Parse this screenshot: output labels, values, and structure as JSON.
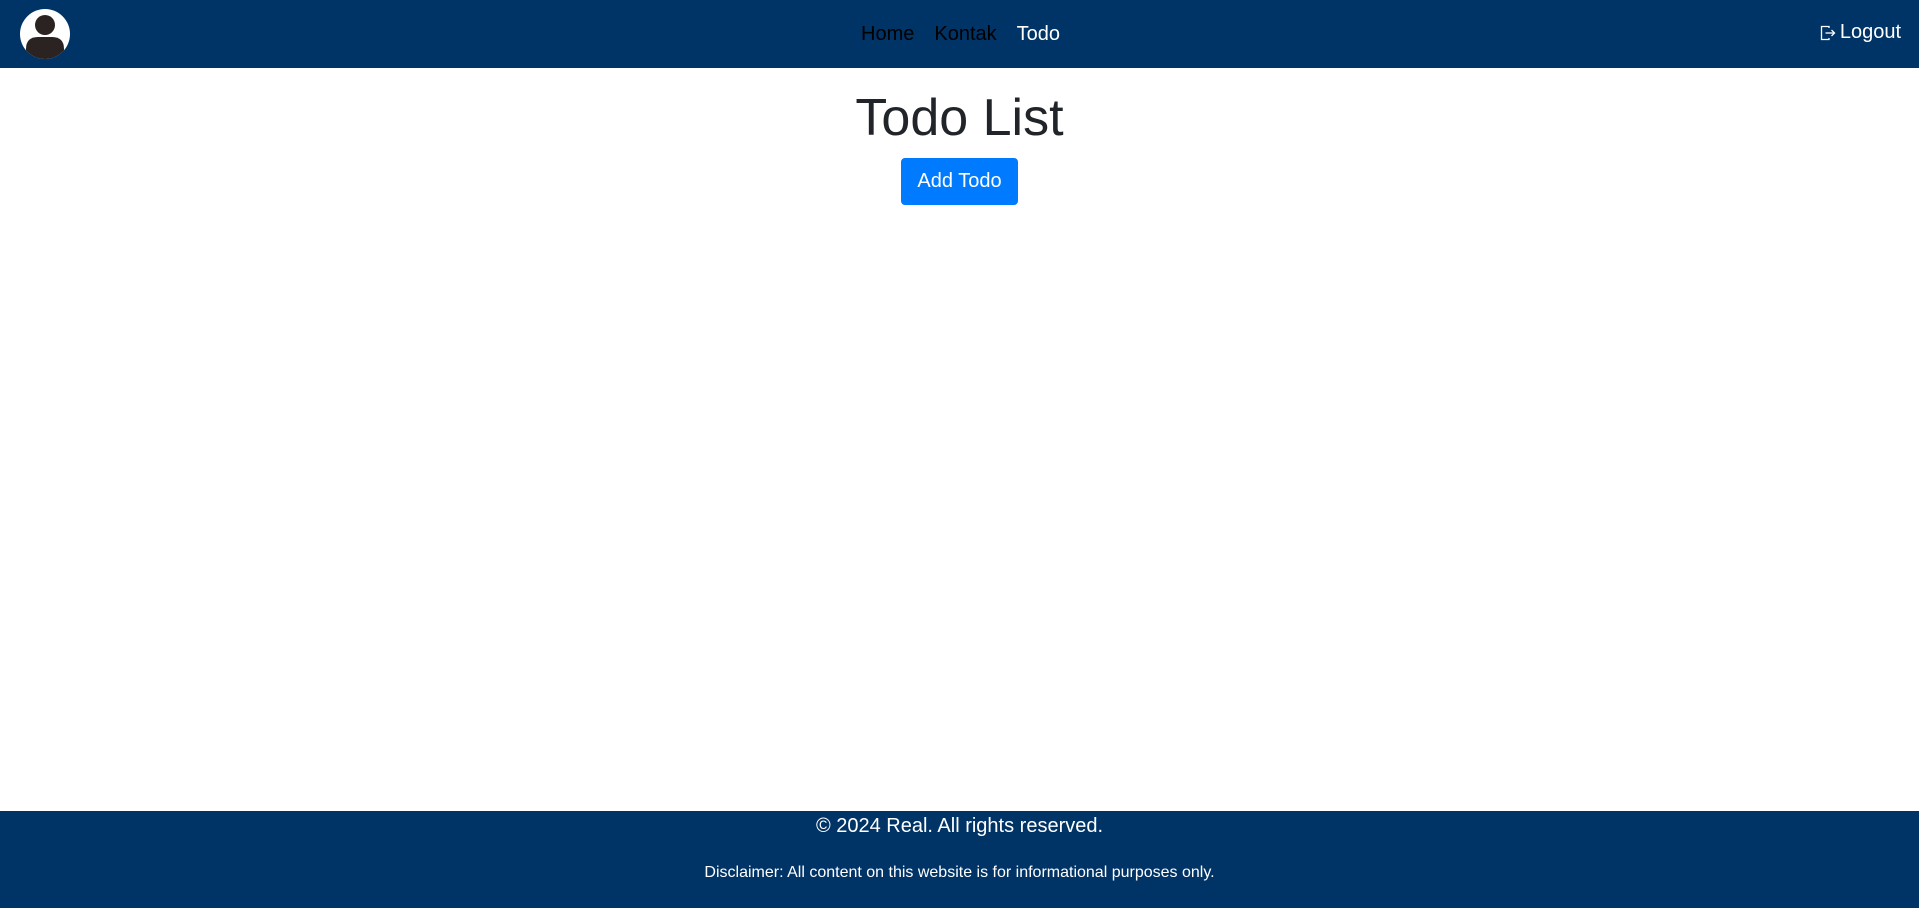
{
  "navbar": {
    "avatar_icon": "user-avatar-icon",
    "links": [
      {
        "label": "Home",
        "active": false
      },
      {
        "label": "Kontak",
        "active": false
      },
      {
        "label": "Todo",
        "active": true
      }
    ],
    "logout_label": "Logout",
    "logout_icon": "logout-icon",
    "background": "#003366"
  },
  "main": {
    "title": "Todo List",
    "add_button_label": "Add Todo",
    "accent": "#007bff"
  },
  "footer": {
    "copyright": "© 2024 Real. All rights reserved.",
    "disclaimer": "Disclaimer: All content on this website is for informational purposes only.",
    "background": "#003366"
  }
}
